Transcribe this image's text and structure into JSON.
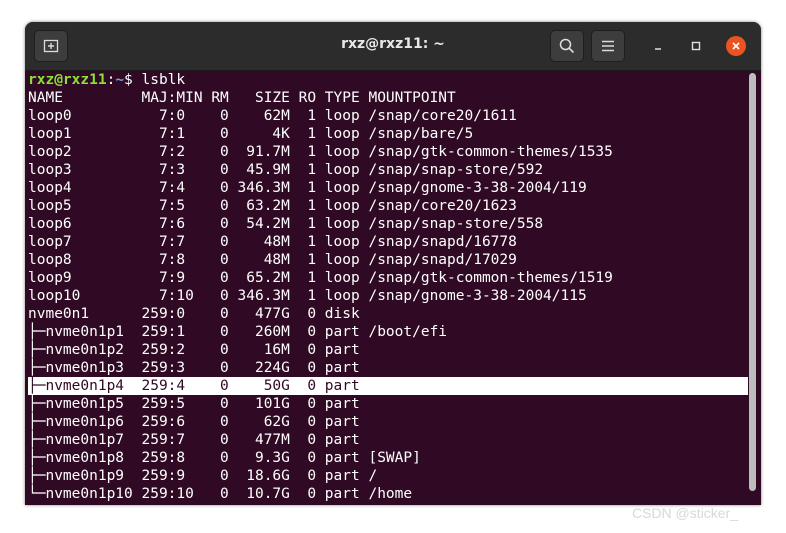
{
  "window": {
    "title": "rxz@rxz11: ~"
  },
  "icons": {
    "new_tab": "new-tab-icon",
    "search": "search-icon",
    "menu": "hamburger-menu-icon",
    "minimize": "minimize-icon",
    "maximize": "maximize-icon",
    "close": "close-icon"
  },
  "colors": {
    "terminal_bg": "#300a24",
    "titlebar_bg": "#2c2c2c",
    "prompt_user": "#8ae234",
    "prompt_path": "#729fcf",
    "close_button": "#e95420"
  },
  "prompt": {
    "user_host": "rxz@rxz11",
    "colon": ":",
    "path": "~",
    "symbol": "$ ",
    "command": "lsblk"
  },
  "output": {
    "header": "NAME         MAJ:MIN RM   SIZE RO TYPE MOUNTPOINT",
    "rows": [
      "loop0          7:0    0    62M  1 loop /snap/core20/1611",
      "loop1          7:1    0     4K  1 loop /snap/bare/5",
      "loop2          7:2    0  91.7M  1 loop /snap/gtk-common-themes/1535",
      "loop3          7:3    0  45.9M  1 loop /snap/snap-store/592",
      "loop4          7:4    0 346.3M  1 loop /snap/gnome-3-38-2004/119",
      "loop5          7:5    0  63.2M  1 loop /snap/core20/1623",
      "loop6          7:6    0  54.2M  1 loop /snap/snap-store/558",
      "loop7          7:7    0    48M  1 loop /snap/snapd/16778",
      "loop8          7:8    0    48M  1 loop /snap/snapd/17029",
      "loop9          7:9    0  65.2M  1 loop /snap/gtk-common-themes/1519",
      "loop10         7:10   0 346.3M  1 loop /snap/gnome-3-38-2004/115",
      "nvme0n1      259:0    0   477G  0 disk ",
      "├─nvme0n1p1  259:1    0   260M  0 part /boot/efi",
      "├─nvme0n1p2  259:2    0    16M  0 part ",
      "├─nvme0n1p3  259:3    0   224G  0 part ",
      "├─nvme0n1p4  259:4    0    50G  0 part ",
      "├─nvme0n1p5  259:5    0   101G  0 part ",
      "├─nvme0n1p6  259:6    0    62G  0 part ",
      "├─nvme0n1p7  259:7    0   477M  0 part ",
      "├─nvme0n1p8  259:8    0   9.3G  0 part [SWAP]",
      "├─nvme0n1p9  259:9    0  18.6G  0 part /",
      "└─nvme0n1p10 259:10   0  10.7G  0 part /home"
    ]
  },
  "watermark": "CSDN @sticker_"
}
